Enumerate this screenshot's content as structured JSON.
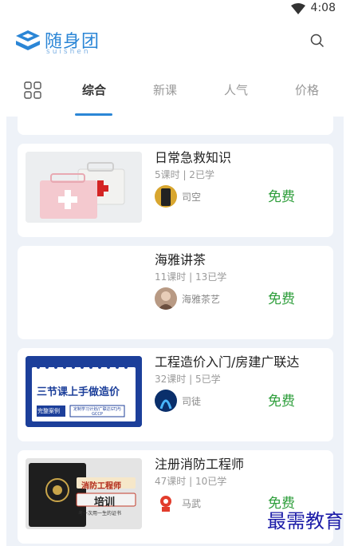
{
  "status": {
    "time": "4:08"
  },
  "header": {
    "brand_name": "随身团",
    "brand_sub": "suishen"
  },
  "tabs": [
    {
      "label": "综合",
      "active": true
    },
    {
      "label": "新课",
      "active": false
    },
    {
      "label": "人气",
      "active": false
    },
    {
      "label": "价格",
      "active": false
    }
  ],
  "courses": [
    {
      "title": "日常急救知识",
      "meta": "5课时 | 2已学",
      "author": "司空",
      "price": "免费"
    },
    {
      "title": "海雅讲茶",
      "meta": "11课时 | 13已学",
      "author": "海雅茶艺",
      "price": "免费"
    },
    {
      "title": "工程造价入门/房建广联达",
      "meta": "32课时 | 5已学",
      "author": "司徒",
      "price": "免费",
      "thumb_text": {
        "main": "三节课上手做造价",
        "tag": "完整案例",
        "tag2": "定制学习计划/广联达GTJ与GCCP"
      }
    },
    {
      "title": "注册消防工程师",
      "meta": "47课时 | 10已学",
      "author": "马武",
      "price": "免费",
      "thumb_text": {
        "line1": "消防工程师",
        "line2": "培训",
        "line3": "考一次用一生的证书"
      }
    }
  ],
  "watermark": "最需教育",
  "colors": {
    "accent": "#2b86d6",
    "free": "#2e9e3b",
    "list_bg": "#eef2f8"
  }
}
